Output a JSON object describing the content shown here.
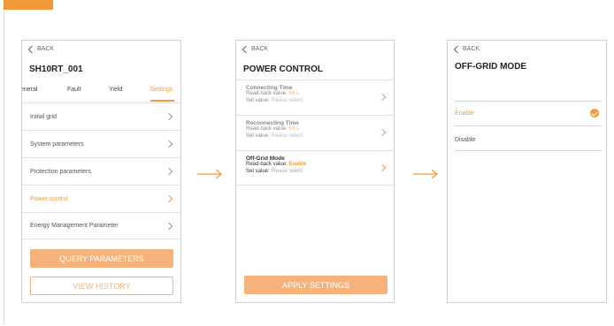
{
  "screens": [
    {
      "back_label": "BACK",
      "title": "SH10RT_001",
      "tabs": [
        {
          "label": "eneral",
          "active": false
        },
        {
          "label": "Fault",
          "active": false
        },
        {
          "label": "Yield",
          "active": false
        },
        {
          "label": "Settings",
          "active": true
        }
      ],
      "rows": [
        {
          "label": "Initial grid",
          "active": false
        },
        {
          "label": "System parameters",
          "active": false
        },
        {
          "label": "Protection parameters",
          "active": false
        },
        {
          "label": "Power control",
          "active": true
        },
        {
          "label": "Energy Management Parameter",
          "active": false
        }
      ],
      "query_button": "QUERY PARAMETERS",
      "history_button": "VIEW HISTORY"
    },
    {
      "back_label": "BACK",
      "title": "POWER CONTROL",
      "blocks": [
        {
          "title": "Connecting Time",
          "readback_label": "Read-back value:",
          "readback_value": "60 s",
          "set_label": "Set value:",
          "set_value": "Please select",
          "active": false
        },
        {
          "title": "Reconnecting Time",
          "readback_label": "Read-back value:",
          "readback_value": "60 s",
          "set_label": "Set value:",
          "set_value": "Please select",
          "active": false
        },
        {
          "title": "Off-Grid Mode",
          "readback_label": "Read-back value:",
          "readback_value": "Enable",
          "set_label": "Set value:",
          "set_value": "Please select",
          "active": true
        }
      ],
      "apply_button": "APPLY SETTINGS"
    },
    {
      "back_label": "BACK",
      "title": "OFF-GRID MODE",
      "options": [
        {
          "label": "Enable",
          "selected": true
        },
        {
          "label": "Disable",
          "selected": false
        }
      ]
    }
  ],
  "colors": {
    "accent": "#f29a3a",
    "accent_light": "#f6b27b",
    "border": "#cfcfcf"
  },
  "icons": [
    "back-chevron-icon",
    "chevron-right-icon",
    "check-circle-icon",
    "arrow-right-icon"
  ]
}
